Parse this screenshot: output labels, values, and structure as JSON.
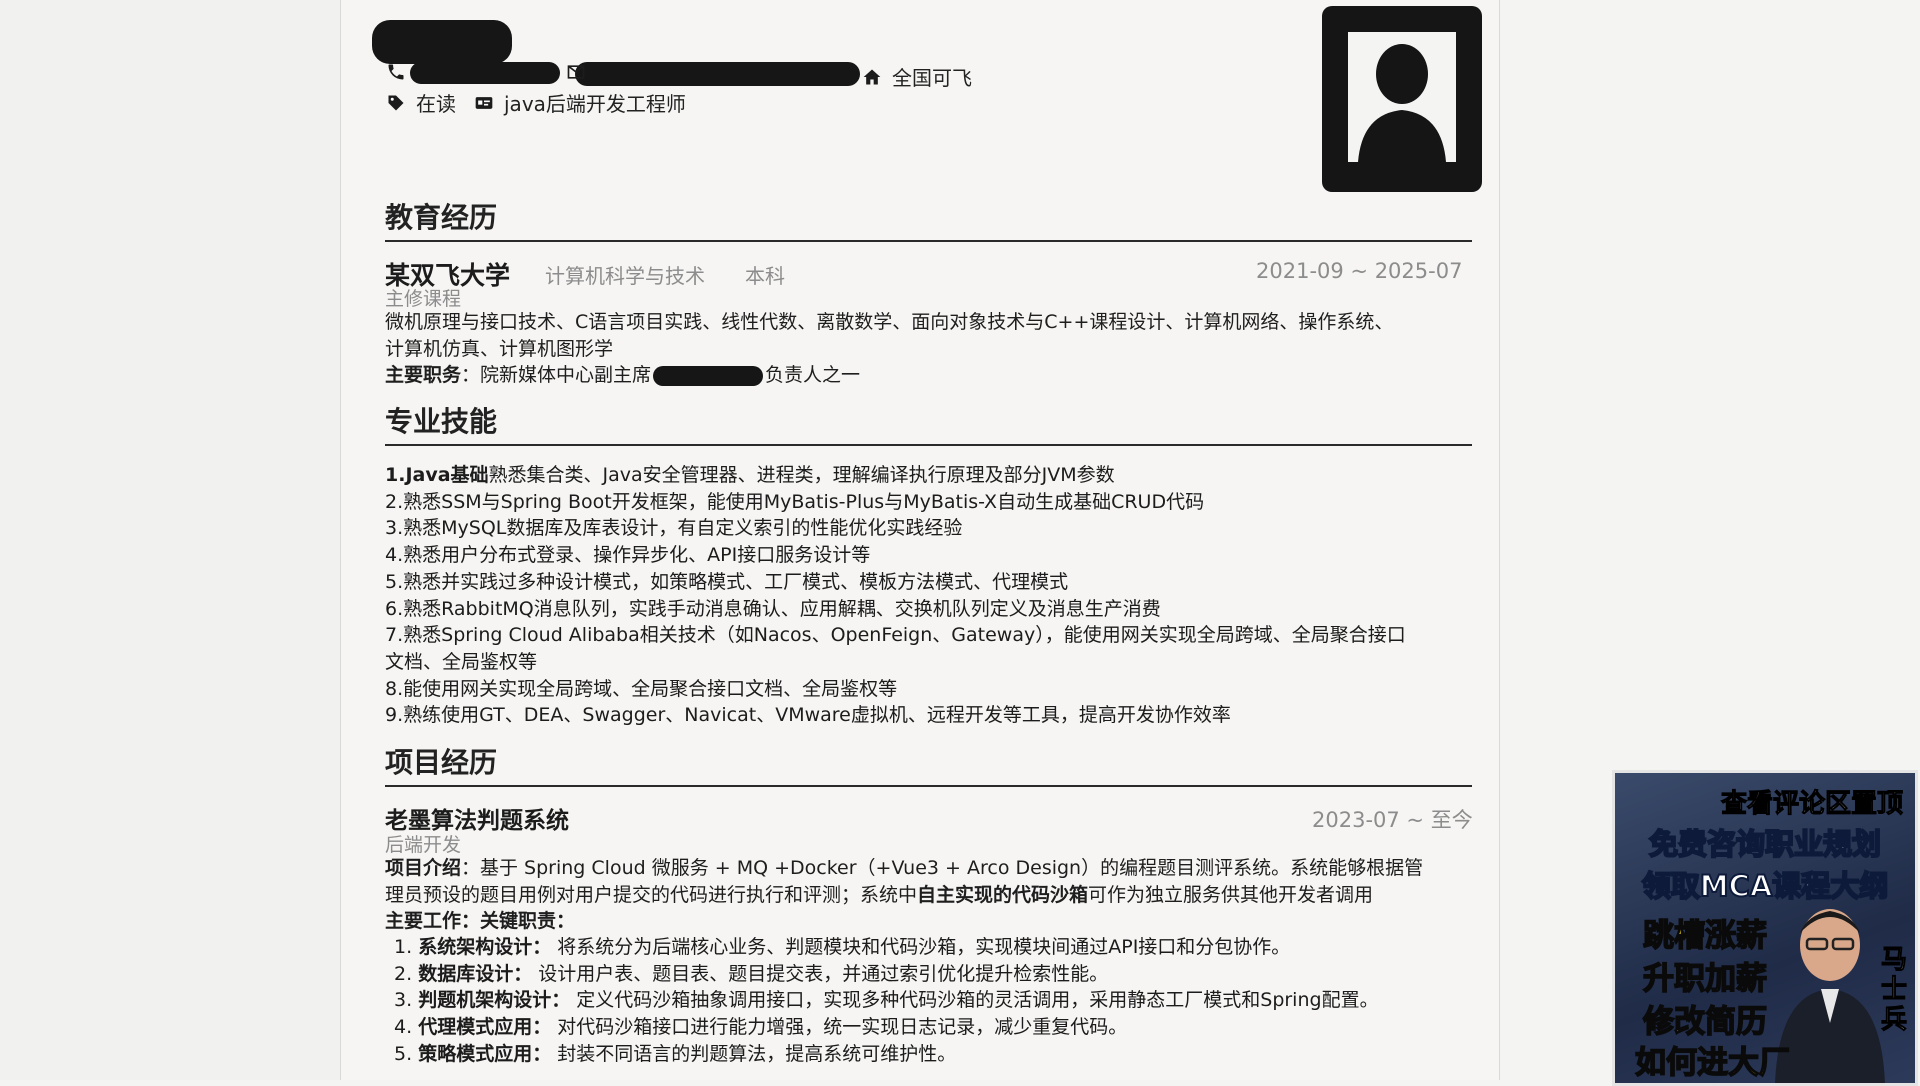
{
  "header": {
    "location": "全国可飞",
    "status": "在读",
    "job_title": "java后端开发工程师"
  },
  "sections": {
    "education": "教育经历",
    "skills": "专业技能",
    "projects": "项目经历"
  },
  "education": {
    "school": "某双飞大学",
    "major": "计算机科学与技术",
    "degree": "本科",
    "dates": "2021-09 ~ 2025-07",
    "courses_label": "主修课程",
    "courses_line1": "微机原理与接口技术、C语言项目实践、线性代数、离散数学、面向对象技术与C++课程设计、计算机网络、操作系统、",
    "courses_line2": "计算机仿真、计算机图形学",
    "duty_label": "主要职务",
    "duty_pre": "：院新媒体中心副主席",
    "duty_post": "负责人之一"
  },
  "skills": [
    {
      "bold": "1.Java基础",
      "text": "熟悉集合类、Java安全管理器、进程类，理解编译执行原理及部分JVM参数"
    },
    {
      "bold": "",
      "text": "2.熟悉SSM与Spring Boot开发框架，能使用MyBatis-Plus与MyBatis-X自动生成基础CRUD代码"
    },
    {
      "bold": "",
      "text": "3.熟悉MySQL数据库及库表设计，有自定义索引的性能优化实践经验"
    },
    {
      "bold": "",
      "text": "4.熟悉用户分布式登录、操作异步化、API接口服务设计等"
    },
    {
      "bold": "",
      "text": "5.熟悉并实践过多种设计模式，如策略模式、工厂模式、模板方法模式、代理模式"
    },
    {
      "bold": "",
      "text": "6.熟悉RabbitMQ消息队列，实践手动消息确认、应用解耦、交换机队列定义及消息生产消费"
    },
    {
      "bold": "",
      "text": "7.熟悉Spring Cloud Alibaba相关技术（如Nacos、OpenFeign、Gateway），能使用网关实现全局跨域、全局聚合接口"
    },
    {
      "bold": "",
      "text": "文档、全局鉴权等"
    },
    {
      "bold": "",
      "text": "8.能使用网关实现全局跨域、全局聚合接口文档、全局鉴权等"
    },
    {
      "bold": "",
      "text": "9.熟练使用GT、DEA、Swagger、Navicat、VMware虚拟机、远程开发等工具，提高开发协作效率"
    }
  ],
  "project": {
    "name": "老墨算法判题系统",
    "dates": "2023-07 ~ 至今",
    "role": "后端开发",
    "intro_label": "项目介绍",
    "intro_line1": "：基于 Spring Cloud 微服务 + MQ +Docker（+Vue3 + Arco Design）的编程题目测评系统。系统能够根据管",
    "intro_line2_pre": "理员预设的题目用例对用户提交的代码进行执行和评测；系统中",
    "intro_line2_bold": "自主实现的代码沙箱",
    "intro_line2_post": "可作为独立服务供其他开发者调用",
    "work_label": "主要工作：关键职责：",
    "responsibilities": [
      {
        "num": "1.",
        "label": "系统架构设计：",
        "text": "将系统分为后端核心业务、判题模块和代码沙箱，实现模块间通过API接口和分包协作。"
      },
      {
        "num": "2.",
        "label": "数据库设计：",
        "text": "设计用户表、题目表、题目提交表，并通过索引优化提升检索性能。"
      },
      {
        "num": "3.",
        "label": "判题机架构设计：",
        "text": "定义代码沙箱抽象调用接口，实现多种代码沙箱的灵活调用，采用静态工厂模式和Spring配置。"
      },
      {
        "num": "4.",
        "label": "代理模式应用：",
        "text": "对代码沙箱接口进行能力增强，统一实现日志记录，减少重复代码。"
      },
      {
        "num": "5.",
        "label": "策略模式应用：",
        "text": "封装不同语言的判题算法，提高系统可维护性。"
      }
    ]
  },
  "promo": {
    "top": "查看评论区置顶",
    "line1": "免费咨询职业规划",
    "line2": "领取MCA课程大纲",
    "items": [
      "跳槽涨薪",
      "升职加薪",
      "修改简历",
      "如何进大厂"
    ],
    "vertical": "马士兵"
  }
}
